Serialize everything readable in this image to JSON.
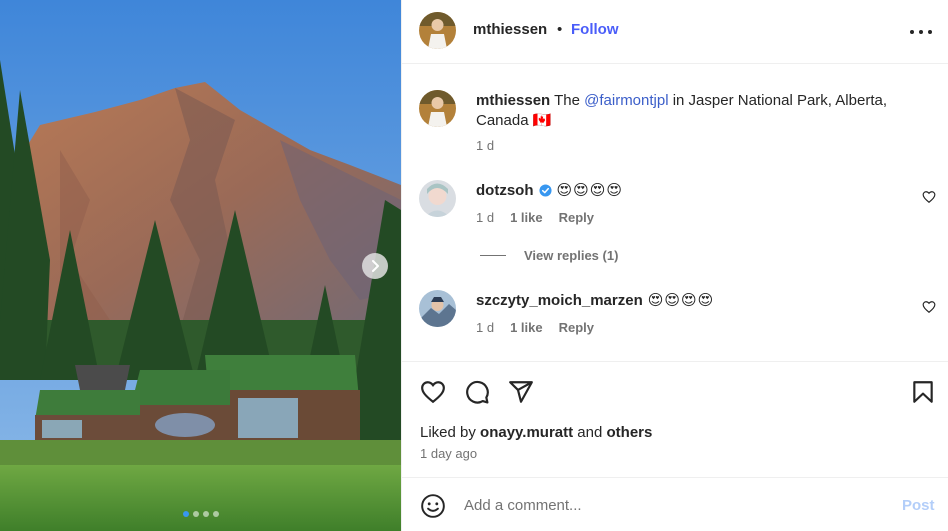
{
  "post": {
    "image_dots": 4,
    "active_dot": 0
  },
  "header": {
    "username": "mthiessen",
    "separator": "•",
    "follow_label": "Follow",
    "more_icon": "more-horizontal-icon"
  },
  "caption": {
    "username": "mthiessen",
    "text_before": "The ",
    "mention": "@fairmontjpl",
    "text_after": " in Jasper National Park, Alberta, Canada 🇨🇦",
    "time": "1 d"
  },
  "comments": [
    {
      "username": "dotzsoh",
      "verified": true,
      "text": "😍😍😍😍",
      "time": "1 d",
      "likes": "1 like",
      "reply_label": "Reply",
      "view_replies": "View replies (1)"
    },
    {
      "username": "szczyty_moich_marzen",
      "verified": false,
      "text": "😍😍😍😍",
      "time": "1 d",
      "likes": "1 like",
      "reply_label": "Reply"
    }
  ],
  "actions": {
    "liked_prefix": "Liked by ",
    "liked_user": "onayy.muratt",
    "liked_and": " and ",
    "liked_others": "others",
    "time_ago": "1 day ago"
  },
  "add_comment": {
    "placeholder": "Add a comment...",
    "post_label": "Post"
  },
  "colors": {
    "follow": "#4a5df9",
    "mention": "#3b5ec9",
    "post_disabled": "#b3cef9",
    "verified": "#3897f0"
  }
}
